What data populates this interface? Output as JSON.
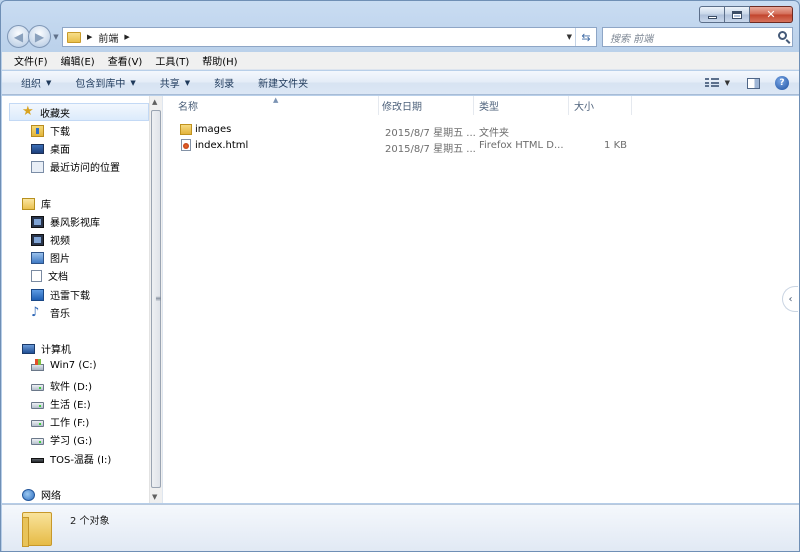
{
  "address": {
    "crumb": "前端",
    "search_placeholder": "搜索 前端"
  },
  "menu": [
    "文件(F)",
    "编辑(E)",
    "查看(V)",
    "工具(T)",
    "帮助(H)"
  ],
  "toolbar": {
    "organize": "组织",
    "include_library": "包含到库中",
    "share": "共享",
    "burn": "刻录",
    "new_folder": "新建文件夹"
  },
  "nav": {
    "favorites": "收藏夹",
    "downloads": "下载",
    "desktop": "桌面",
    "recent": "最近访问的位置",
    "libraries": "库",
    "baofeng": "暴风影视库",
    "videos": "视频",
    "pictures": "图片",
    "documents": "文档",
    "xunlei": "迅雷下载",
    "music": "音乐",
    "computer": "计算机",
    "drive_c": "Win7 (C:)",
    "drive_d": "软件 (D:)",
    "drive_e": "生活 (E:)",
    "drive_f": "工作 (F:)",
    "drive_g": "学习 (G:)",
    "drive_i": "TOS-温磊 (I:)",
    "network": "网络"
  },
  "columns": {
    "name": "名称",
    "modified": "修改日期",
    "type": "类型",
    "size": "大小"
  },
  "files": [
    {
      "name": "images",
      "date": "2015/8/7 星期五 ...",
      "type": "文件夹",
      "size": "",
      "icon": "folder-icon"
    },
    {
      "name": "index.html",
      "date": "2015/8/7 星期五 ...",
      "type": "Firefox HTML D...",
      "size": "1 KB",
      "icon": "html-file-icon"
    }
  ],
  "status": {
    "count": "2 个对象"
  }
}
